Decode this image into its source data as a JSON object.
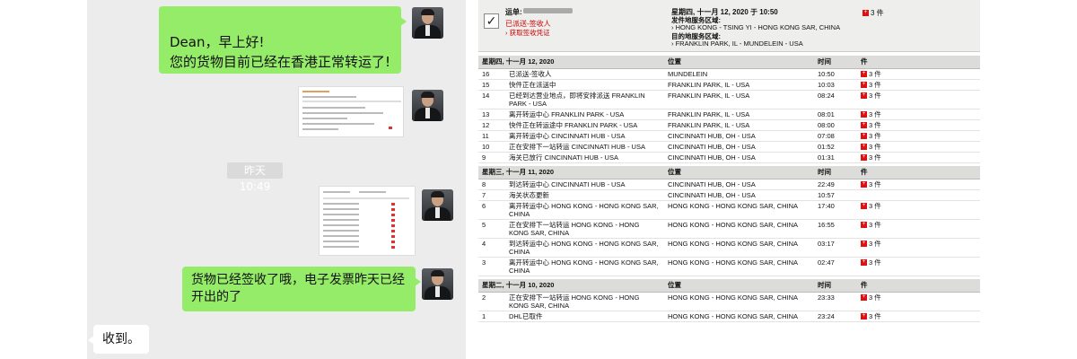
{
  "chat": {
    "messages": [
      {
        "text": "Dean，早上好!\n您的货物目前已经在香港正常转运了!"
      },
      {
        "text": "货物已经签收了哦，电子发票昨天已经开出的了"
      },
      {
        "text": "收到。"
      }
    ],
    "timestamp": "昨天 10:49"
  },
  "tracking": {
    "summary": {
      "waybill_label": "运单:",
      "status": "已派送-签收人",
      "proof_link": "获取签收凭证",
      "date": "星期四, 十一月 12, 2020 于 10:50",
      "origin_label": "发件地服务区域:",
      "origin": "HONG KONG - TSING YI - HONG KONG SAR, CHINA",
      "dest_label": "目的地服务区域:",
      "dest": "FRANKLIN PARK, IL - MUNDELEIN - USA",
      "pieces": "3 件",
      "checkmark": "✓",
      "bullet": "›"
    },
    "columns": {
      "location": "位置",
      "time": "时间",
      "pieces": "件"
    },
    "groups": [
      {
        "date": "星期四, 十一月 12, 2020",
        "rows": [
          {
            "no": "16",
            "desc": "已派送-签收人",
            "loc": "MUNDELEIN",
            "time": "10:50",
            "pcs": "3 件"
          },
          {
            "no": "15",
            "desc": "快件正在派送中",
            "loc": "FRANKLIN PARK, IL - USA",
            "time": "10:03",
            "pcs": "3 件"
          },
          {
            "no": "14",
            "desc": "已经到达营业地点，即将安排派送 FRANKLIN PARK - USA",
            "loc": "FRANKLIN PARK, IL - USA",
            "time": "08:24",
            "pcs": "3 件"
          },
          {
            "no": "13",
            "desc": "离开转运中心 FRANKLIN PARK - USA",
            "loc": "FRANKLIN PARK, IL - USA",
            "time": "08:01",
            "pcs": "3 件"
          },
          {
            "no": "12",
            "desc": "快件正在转运途中 FRANKLIN PARK - USA",
            "loc": "FRANKLIN PARK, IL - USA",
            "time": "08:00",
            "pcs": "3 件"
          },
          {
            "no": "11",
            "desc": "离开转运中心 CINCINNATI HUB - USA",
            "loc": "CINCINNATI HUB, OH - USA",
            "time": "07:08",
            "pcs": "3 件"
          },
          {
            "no": "10",
            "desc": "正在安排下一站转运 CINCINNATI HUB - USA",
            "loc": "CINCINNATI HUB, OH - USA",
            "time": "01:52",
            "pcs": "3 件"
          },
          {
            "no": "9",
            "desc": "海关已放行 CINCINNATI HUB - USA",
            "loc": "CINCINNATI HUB, OH - USA",
            "time": "01:31",
            "pcs": "3 件"
          }
        ]
      },
      {
        "date": "星期三, 十一月 11, 2020",
        "rows": [
          {
            "no": "8",
            "desc": "到达转运中心 CINCINNATI HUB - USA",
            "loc": "CINCINNATI HUB, OH - USA",
            "time": "22:49",
            "pcs": "3 件"
          },
          {
            "no": "7",
            "desc": "海关状态更新",
            "loc": "CINCINNATI HUB, OH - USA",
            "time": "10:57",
            "pcs": ""
          },
          {
            "no": "6",
            "desc": "离开转运中心 HONG KONG - HONG KONG SAR, CHINA",
            "loc": "HONG KONG - HONG KONG SAR, CHINA",
            "time": "17:40",
            "pcs": "3 件"
          },
          {
            "no": "5",
            "desc": "正在安排下一站转运 HONG KONG - HONG KONG SAR, CHINA",
            "loc": "HONG KONG - HONG KONG SAR, CHINA",
            "time": "16:55",
            "pcs": "3 件"
          },
          {
            "no": "4",
            "desc": "到达转运中心 HONG KONG - HONG KONG SAR, CHINA",
            "loc": "HONG KONG - HONG KONG SAR, CHINA",
            "time": "03:17",
            "pcs": "3 件"
          },
          {
            "no": "3",
            "desc": "离开转运中心 HONG KONG - HONG KONG SAR, CHINA",
            "loc": "HONG KONG - HONG KONG SAR, CHINA",
            "time": "02:47",
            "pcs": "3 件"
          }
        ]
      },
      {
        "date": "星期二, 十一月 10, 2020",
        "rows": [
          {
            "no": "2",
            "desc": "正在安排下一站转运 HONG KONG - HONG KONG SAR, CHINA",
            "loc": "HONG KONG - HONG KONG SAR, CHINA",
            "time": "23:33",
            "pcs": "3 件"
          },
          {
            "no": "1",
            "desc": "DHL已取件",
            "loc": "HONG KONG - HONG KONG SAR, CHINA",
            "time": "23:24",
            "pcs": "3 件"
          }
        ]
      }
    ]
  },
  "colors": {
    "bubble_green": "#95ec69",
    "status_red": "#cc0000"
  }
}
